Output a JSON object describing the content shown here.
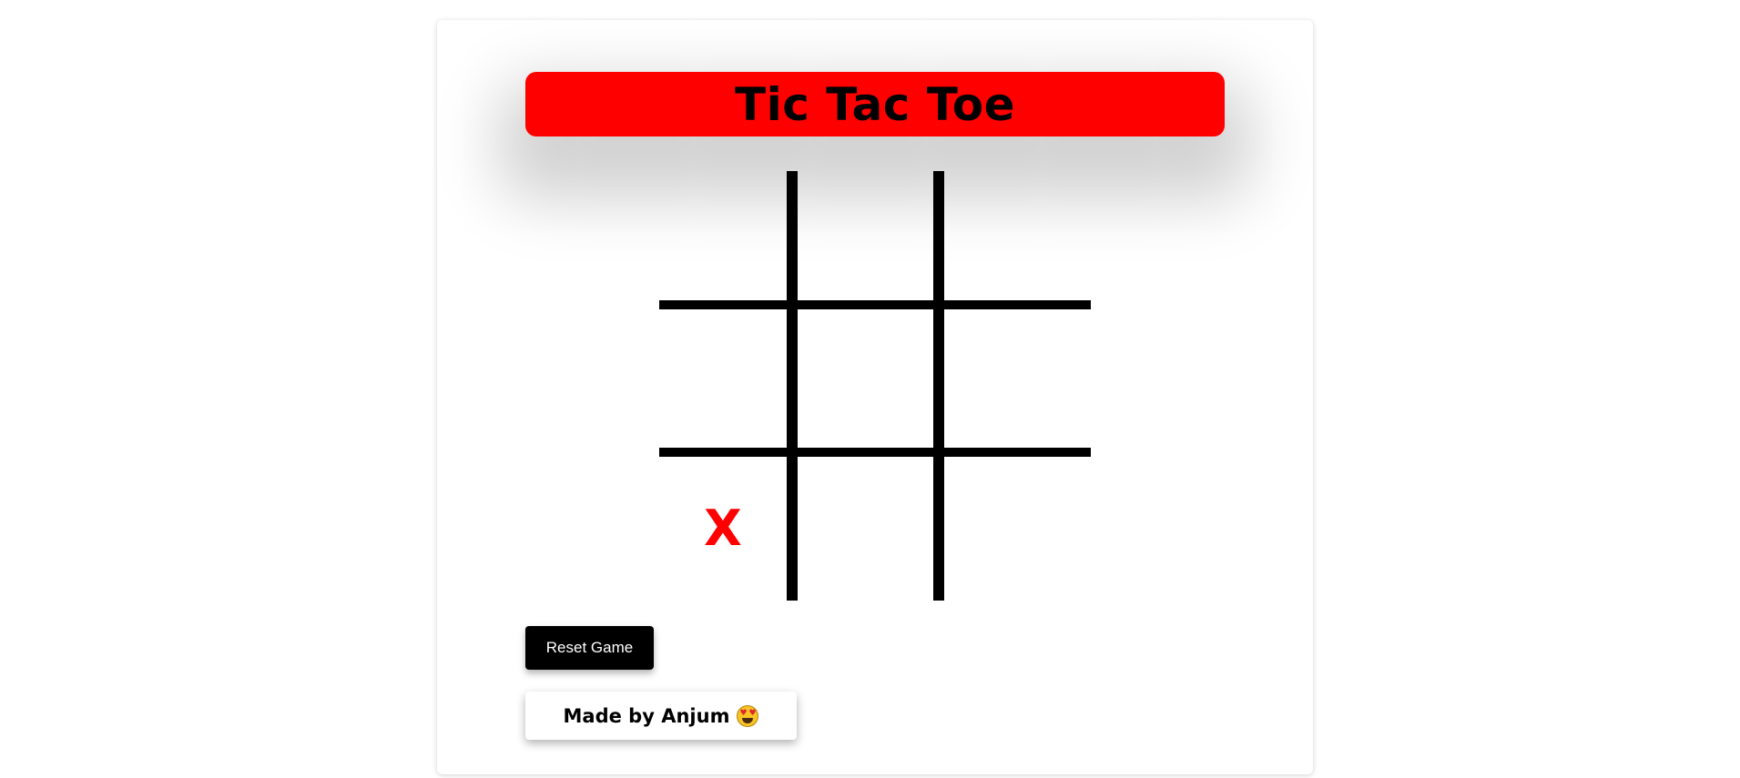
{
  "title": "Tic Tac Toe",
  "board": {
    "cells": [
      "",
      "",
      "",
      "",
      "",
      "",
      "X",
      "",
      ""
    ]
  },
  "reset_label": "Reset Game",
  "credit": {
    "text": "Made by Anjum",
    "emoji_icon": "heart-eyes-face-icon"
  },
  "colors": {
    "title_bar": "#ff0000",
    "x_mark": "#ff0000",
    "grid": "#000000",
    "reset_button": "#000000"
  }
}
